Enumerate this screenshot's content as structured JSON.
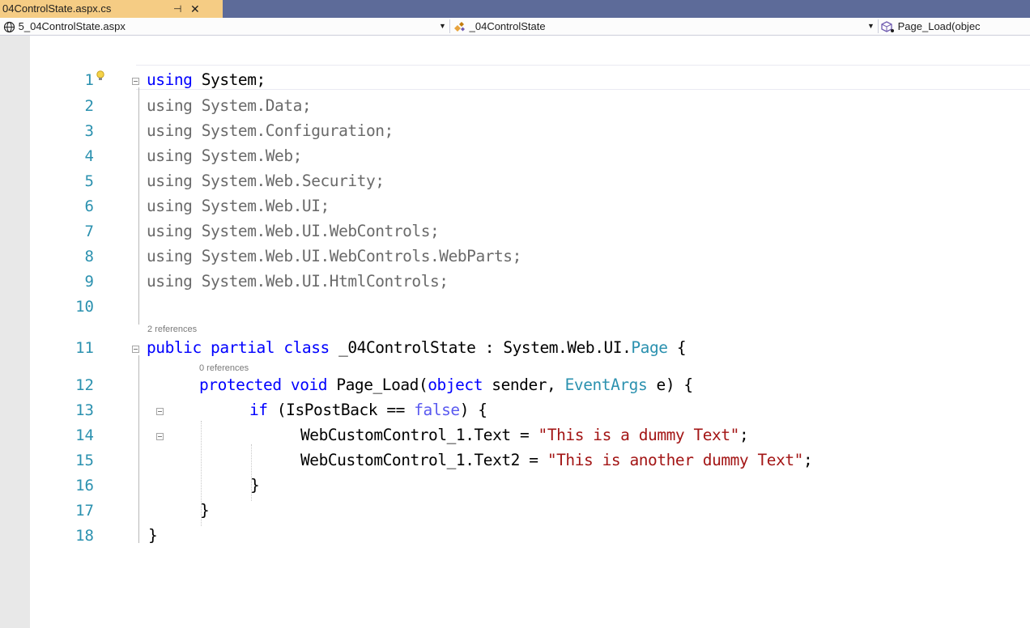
{
  "tab": {
    "title": "04ControlState.aspx.cs",
    "pin_glyph": "⊣",
    "close_glyph": "✕"
  },
  "navbar": {
    "project": "5_04ControlState.aspx",
    "type": "_04ControlState",
    "member": "Page_Load(objec"
  },
  "editor": {
    "lines": [
      {
        "n": "1"
      },
      {
        "n": "2"
      },
      {
        "n": "3"
      },
      {
        "n": "4"
      },
      {
        "n": "5"
      },
      {
        "n": "6"
      },
      {
        "n": "7"
      },
      {
        "n": "8"
      },
      {
        "n": "9"
      },
      {
        "n": "10"
      },
      {
        "n": "11"
      },
      {
        "n": "12"
      },
      {
        "n": "13"
      },
      {
        "n": "14"
      },
      {
        "n": "15"
      },
      {
        "n": "16"
      },
      {
        "n": "17"
      },
      {
        "n": "18"
      }
    ],
    "code": {
      "l1_kw": "using",
      "l1_rest": " System;",
      "l2": "using System.Data;",
      "l3": "using System.Configuration;",
      "l4": "using System.Web;",
      "l5": "using System.Web.Security;",
      "l6": "using System.Web.UI;",
      "l7": "using System.Web.UI.WebControls;",
      "l8": "using System.Web.UI.WebControls.WebParts;",
      "l9": "using System.Web.UI.HtmlControls;",
      "l11_kw": "public partial class",
      "l11_name": " _04ControlState : System.Web.UI.",
      "l11_type": "Page",
      "l11_end": " {",
      "l12_kw": "protected void",
      "l12_name": " Page_Load(",
      "l12_kw2": "object",
      "l12_mid": " sender, ",
      "l12_type": "EventArgs",
      "l12_end": " e) {",
      "l13_kw": "if",
      "l13_mid": " (IsPostBack == ",
      "l13_kw2": "false",
      "l13_end": ") {",
      "l14_pre": "WebCustomControl_1.Text = ",
      "l14_str": "\"This is a dummy Text\"",
      "l14_end": ";",
      "l15_pre": "WebCustomControl_1.Text2 = ",
      "l15_str": "\"This is another dummy Text\"",
      "l15_end": ";",
      "l16": "}",
      "l17": "}",
      "l18": "}"
    },
    "lens": {
      "class_refs": "2 references",
      "method_refs": "0 references"
    }
  },
  "colors": {
    "tab_active": "#f5cc84",
    "tab_strip": "#5d6b99",
    "keyword": "#0000ff",
    "type": "#2b91af",
    "string": "#a31515",
    "line_number": "#2b91af"
  }
}
